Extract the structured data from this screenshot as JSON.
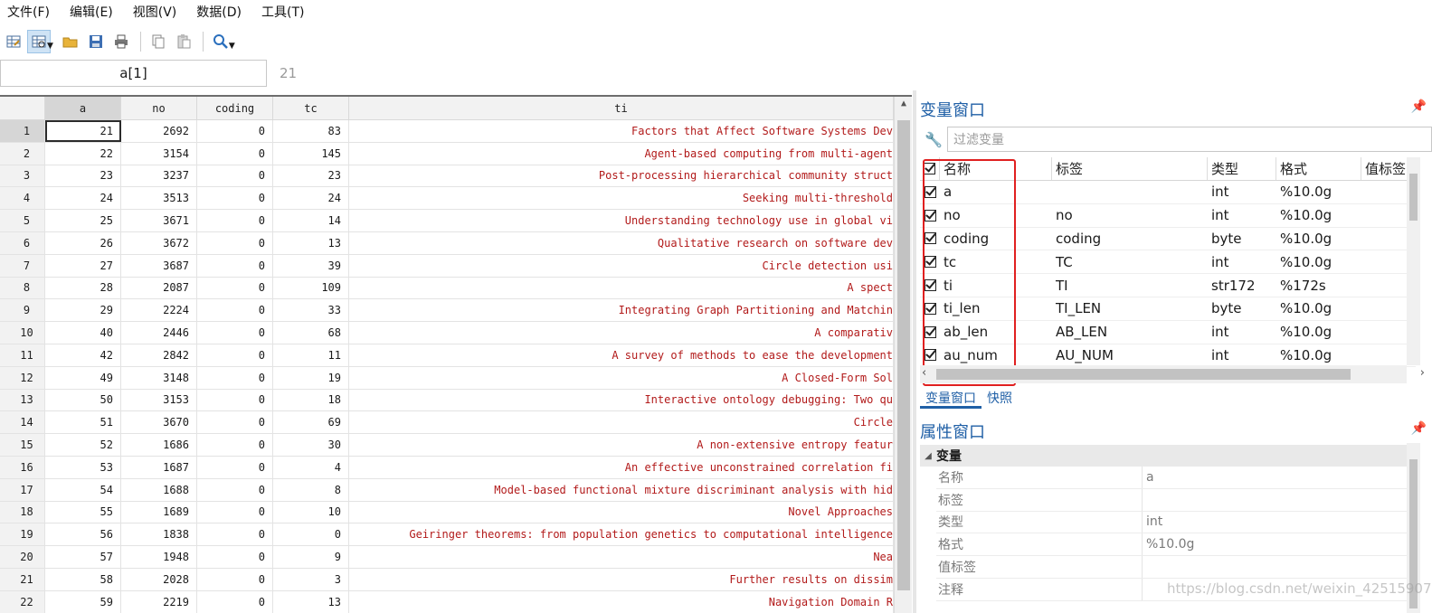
{
  "menu": [
    "文件(F)",
    "编辑(E)",
    "视图(V)",
    "数据(D)",
    "工具(T)"
  ],
  "toolbar": {
    "icons": [
      "data-editor-icon",
      "data-browser-icon",
      "open-folder-icon",
      "save-icon",
      "print-icon",
      "copy-icon",
      "paste-icon",
      "search-icon"
    ]
  },
  "formula": {
    "cell_ref": "a[1]",
    "cell_value": "21"
  },
  "grid": {
    "columns": [
      "a",
      "no",
      "coding",
      "tc",
      "ti"
    ],
    "rows": [
      {
        "n": "1",
        "a": "21",
        "no": "2692",
        "coding": "0",
        "tc": "83",
        "ti": "Factors that Affect Software Systems Dev"
      },
      {
        "n": "2",
        "a": "22",
        "no": "3154",
        "coding": "0",
        "tc": "145",
        "ti": "Agent-based computing from multi-agent"
      },
      {
        "n": "3",
        "a": "23",
        "no": "3237",
        "coding": "0",
        "tc": "23",
        "ti": "Post-processing hierarchical community struct"
      },
      {
        "n": "4",
        "a": "24",
        "no": "3513",
        "coding": "0",
        "tc": "24",
        "ti": "Seeking multi-threshold"
      },
      {
        "n": "5",
        "a": "25",
        "no": "3671",
        "coding": "0",
        "tc": "14",
        "ti": "Understanding technology use in global vi"
      },
      {
        "n": "6",
        "a": "26",
        "no": "3672",
        "coding": "0",
        "tc": "13",
        "ti": "Qualitative research on software dev"
      },
      {
        "n": "7",
        "a": "27",
        "no": "3687",
        "coding": "0",
        "tc": "39",
        "ti": "Circle detection usi"
      },
      {
        "n": "8",
        "a": "28",
        "no": "2087",
        "coding": "0",
        "tc": "109",
        "ti": "A spect"
      },
      {
        "n": "9",
        "a": "29",
        "no": "2224",
        "coding": "0",
        "tc": "33",
        "ti": "Integrating Graph Partitioning and Matchin"
      },
      {
        "n": "10",
        "a": "40",
        "no": "2446",
        "coding": "0",
        "tc": "68",
        "ti": "A comparativ"
      },
      {
        "n": "11",
        "a": "42",
        "no": "2842",
        "coding": "0",
        "tc": "11",
        "ti": "A survey of methods to ease the development"
      },
      {
        "n": "12",
        "a": "49",
        "no": "3148",
        "coding": "0",
        "tc": "19",
        "ti": "A Closed-Form Sol"
      },
      {
        "n": "13",
        "a": "50",
        "no": "3153",
        "coding": "0",
        "tc": "18",
        "ti": "Interactive ontology debugging: Two qu"
      },
      {
        "n": "14",
        "a": "51",
        "no": "3670",
        "coding": "0",
        "tc": "69",
        "ti": "Circle"
      },
      {
        "n": "15",
        "a": "52",
        "no": "1686",
        "coding": "0",
        "tc": "30",
        "ti": "A non-extensive entropy featur"
      },
      {
        "n": "16",
        "a": "53",
        "no": "1687",
        "coding": "0",
        "tc": "4",
        "ti": "An effective unconstrained correlation fi"
      },
      {
        "n": "17",
        "a": "54",
        "no": "1688",
        "coding": "0",
        "tc": "8",
        "ti": "Model-based functional mixture discriminant analysis with hid"
      },
      {
        "n": "18",
        "a": "55",
        "no": "1689",
        "coding": "0",
        "tc": "10",
        "ti": "Novel Approaches"
      },
      {
        "n": "19",
        "a": "56",
        "no": "1838",
        "coding": "0",
        "tc": "0",
        "ti": "Geiringer theorems: from population genetics to computational intelligence"
      },
      {
        "n": "20",
        "a": "57",
        "no": "1948",
        "coding": "0",
        "tc": "9",
        "ti": "Nea"
      },
      {
        "n": "21",
        "a": "58",
        "no": "2028",
        "coding": "0",
        "tc": "3",
        "ti": "Further results on dissim"
      },
      {
        "n": "22",
        "a": "59",
        "no": "2219",
        "coding": "0",
        "tc": "13",
        "ti": "Navigation Domain R"
      }
    ]
  },
  "variables_panel": {
    "title": "变量窗口",
    "filter_placeholder": "过滤变量",
    "headers": [
      "名称",
      "标签",
      "类型",
      "格式",
      "值标签"
    ],
    "vars": [
      {
        "name": "a",
        "label": "",
        "type": "int",
        "format": "%10.0g"
      },
      {
        "name": "no",
        "label": "no",
        "type": "int",
        "format": "%10.0g"
      },
      {
        "name": "coding",
        "label": "coding",
        "type": "byte",
        "format": "%10.0g"
      },
      {
        "name": "tc",
        "label": "TC",
        "type": "int",
        "format": "%10.0g"
      },
      {
        "name": "ti",
        "label": "TI",
        "type": "str172",
        "format": "%172s"
      },
      {
        "name": "ti_len",
        "label": "TI_LEN",
        "type": "byte",
        "format": "%10.0g"
      },
      {
        "name": "ab_len",
        "label": "AB_LEN",
        "type": "int",
        "format": "%10.0g"
      },
      {
        "name": "au_num",
        "label": "AU_NUM",
        "type": "int",
        "format": "%10.0g"
      }
    ],
    "tabs": [
      "变量窗口",
      "快照"
    ]
  },
  "properties_panel": {
    "title": "属性窗口",
    "section": "变量",
    "rows": [
      {
        "key": "名称",
        "value": "a"
      },
      {
        "key": "标签",
        "value": ""
      },
      {
        "key": "类型",
        "value": "int"
      },
      {
        "key": "格式",
        "value": "%10.0g"
      },
      {
        "key": "值标签",
        "value": ""
      },
      {
        "key": "注释",
        "value": ""
      }
    ]
  },
  "watermark": "https://blog.csdn.net/weixin_42515907",
  "colors": {
    "accent": "#1f5fa6",
    "ti_text": "#b21a1a",
    "highlight_box": "#e02020"
  }
}
